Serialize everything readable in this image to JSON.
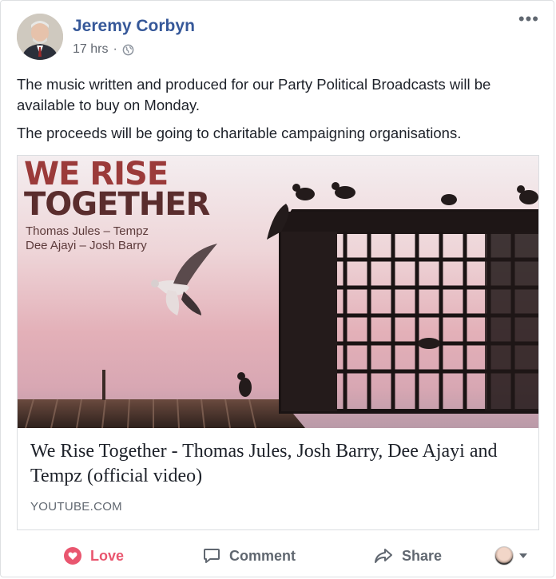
{
  "post": {
    "author": "Jeremy Corbyn",
    "time": "17 hrs",
    "separator": "·",
    "privacy_icon": "globe-icon",
    "more_label": "•••",
    "paragraphs": [
      "The music written and produced for our Party Political Broadcasts will be available to buy on Monday.",
      "The proceeds will be going to charitable campaigning organisations."
    ]
  },
  "link_card": {
    "image_overlay": {
      "title_line1": "WE RISE",
      "title_line2": "TOGETHER",
      "artists_line1": "Thomas Jules – Tempz",
      "artists_line2": "Dee Ajayi – Josh Barry"
    },
    "title": "We Rise Together - Thomas Jules, Josh Barry, Dee Ajayi and Tempz (official video)",
    "domain": "YOUTUBE.COM"
  },
  "actions": {
    "love": "Love",
    "comment": "Comment",
    "share": "Share"
  },
  "colors": {
    "author": "#365899",
    "love": "#e9566f",
    "muted": "#606770"
  }
}
